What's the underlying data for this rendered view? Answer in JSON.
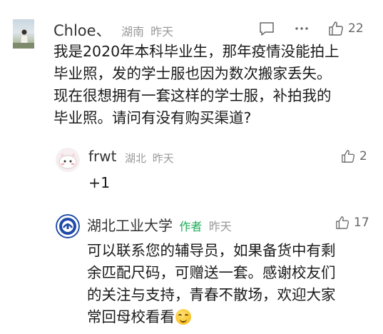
{
  "comments": [
    {
      "author": "Chloe、",
      "location": "湖南",
      "time": "昨天",
      "likes": "22",
      "lines": [
        "我是2020年本科毕业生，那年疫情没能拍上",
        "毕业照，发的学士服也因为数次搬家丢失。",
        "现在很想拥有一套这样的学士服，补拍我的",
        "毕业照。请问有没有购买渠道?"
      ]
    },
    {
      "author": "frwt",
      "location": "湖北",
      "time": "昨天",
      "likes": "2",
      "lines": [
        "+1"
      ]
    },
    {
      "author": "湖北工业大学",
      "author_tag": "作者",
      "time": "昨天",
      "likes": "17",
      "lines": [
        "可以联系您的辅导员，如果备货中有剩",
        "余匹配尺码，可赠送一套。感谢校友们",
        "的关注与支持，青春不散场，欢迎大家",
        "常回母校看看"
      ],
      "emoji": "smile-emoji"
    }
  ],
  "colors": {
    "text": "#1a1a1a",
    "meta": "#999999",
    "author_tag": "#1aaa55",
    "icon": "#666666"
  }
}
